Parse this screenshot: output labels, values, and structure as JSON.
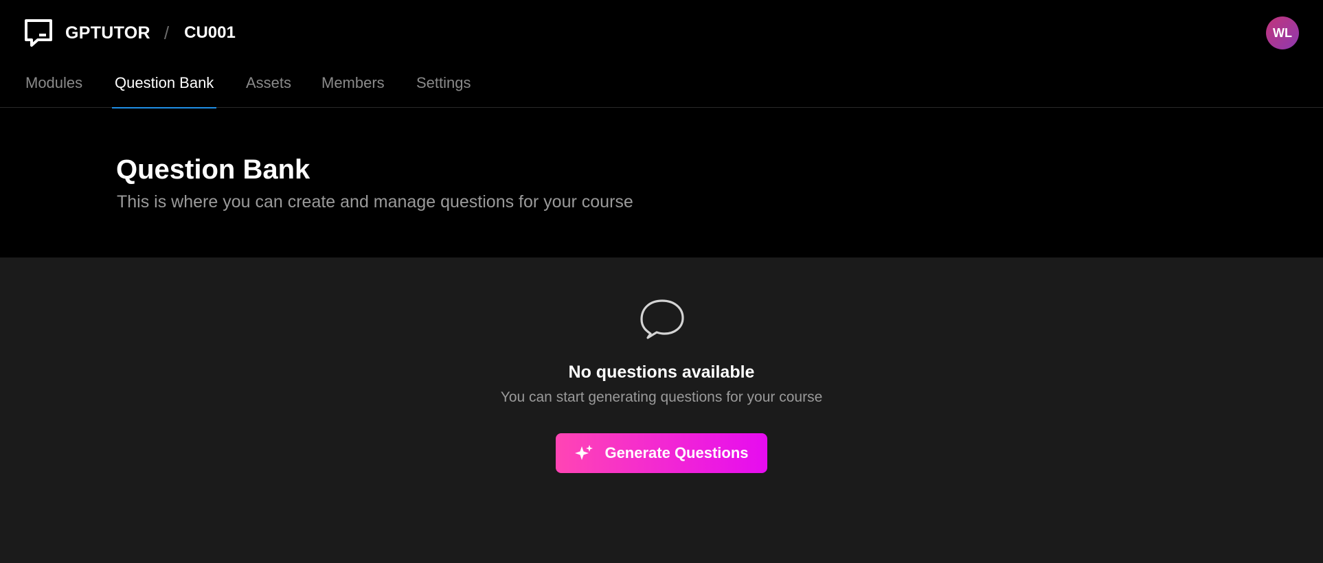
{
  "app": {
    "name": "GPTUTOR",
    "breadcrumb_separator": "/",
    "course_code": "CU001",
    "user_initials": "WL"
  },
  "nav": {
    "tabs": [
      {
        "label": "Modules",
        "active": false
      },
      {
        "label": "Question Bank",
        "active": true
      },
      {
        "label": "Assets",
        "active": false
      },
      {
        "label": "Members",
        "active": false
      },
      {
        "label": "Settings",
        "active": false
      }
    ]
  },
  "page": {
    "title": "Question Bank",
    "subtitle": "This is where you can create and manage questions for your course"
  },
  "empty_state": {
    "icon": "chat-bubble-icon",
    "title": "No questions available",
    "subtitle": "You can start generating questions for your course",
    "button_label": "Generate Questions",
    "button_icon": "sparkle-icon"
  },
  "colors": {
    "active_tab_underline": "#1f8fe6",
    "button_gradient_start": "#ff45b4",
    "button_gradient_end": "#e60cf0",
    "avatar": "#a8378f"
  }
}
